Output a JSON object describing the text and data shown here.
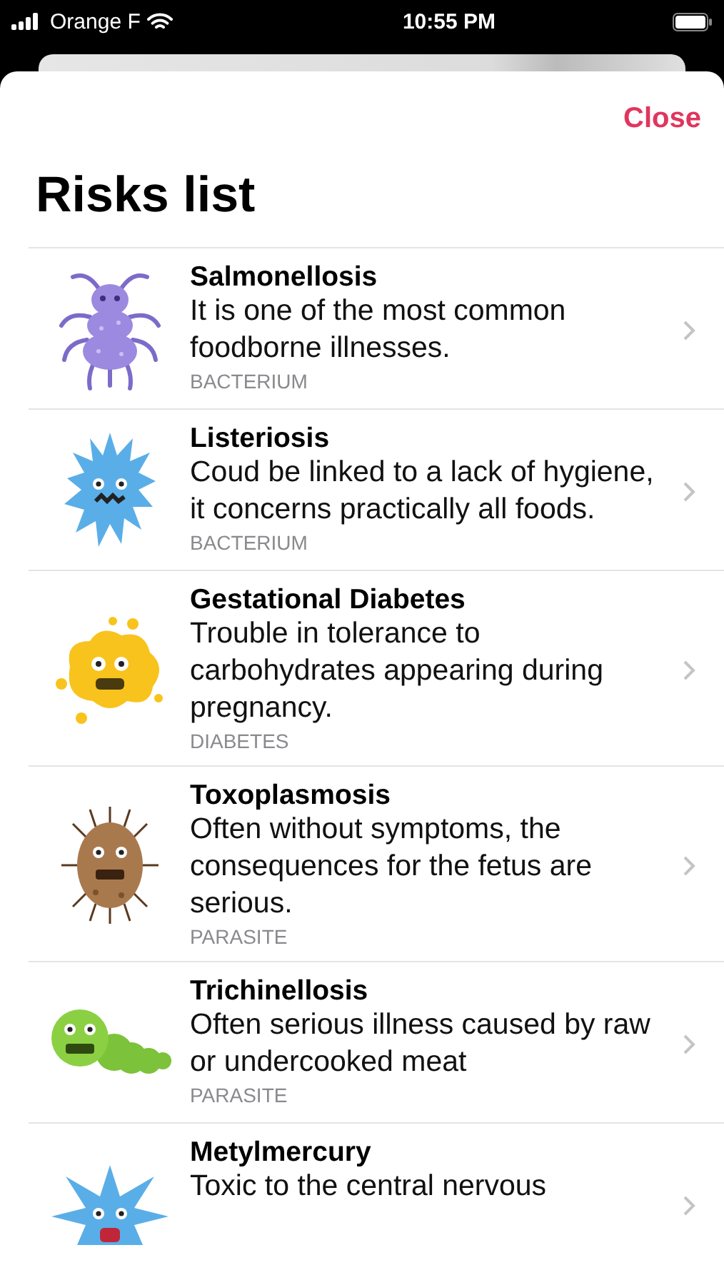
{
  "status_bar": {
    "carrier": "Orange F",
    "time": "10:55 PM"
  },
  "header": {
    "close": "Close",
    "title": "Risks list"
  },
  "risks": [
    {
      "kind": "bug",
      "title": "Salmonellosis",
      "description": "It is one of the most common foodborne illnesses.",
      "category": "BACTERIUM"
    },
    {
      "kind": "spiky",
      "title": "Listeriosis",
      "description": "Coud be linked to a lack of hygiene, it concerns practically all foods.",
      "category": "BACTERIUM"
    },
    {
      "kind": "blob",
      "title": "Gestational Diabetes",
      "description": "Trouble in tolerance to carbohydrates appearing during pregnancy.",
      "category": "DIABETES"
    },
    {
      "kind": "hairy",
      "title": "Toxoplasmosis",
      "description": "Often without symptoms, the consequences for the fetus are serious.",
      "category": "PARASITE"
    },
    {
      "kind": "worm",
      "title": "Trichinellosis",
      "description": "Often serious illness caused by raw or undercooked meat",
      "category": "PARASITE"
    },
    {
      "kind": "star",
      "title": "Metylmercury",
      "description": "Toxic to the central nervous"
    }
  ]
}
